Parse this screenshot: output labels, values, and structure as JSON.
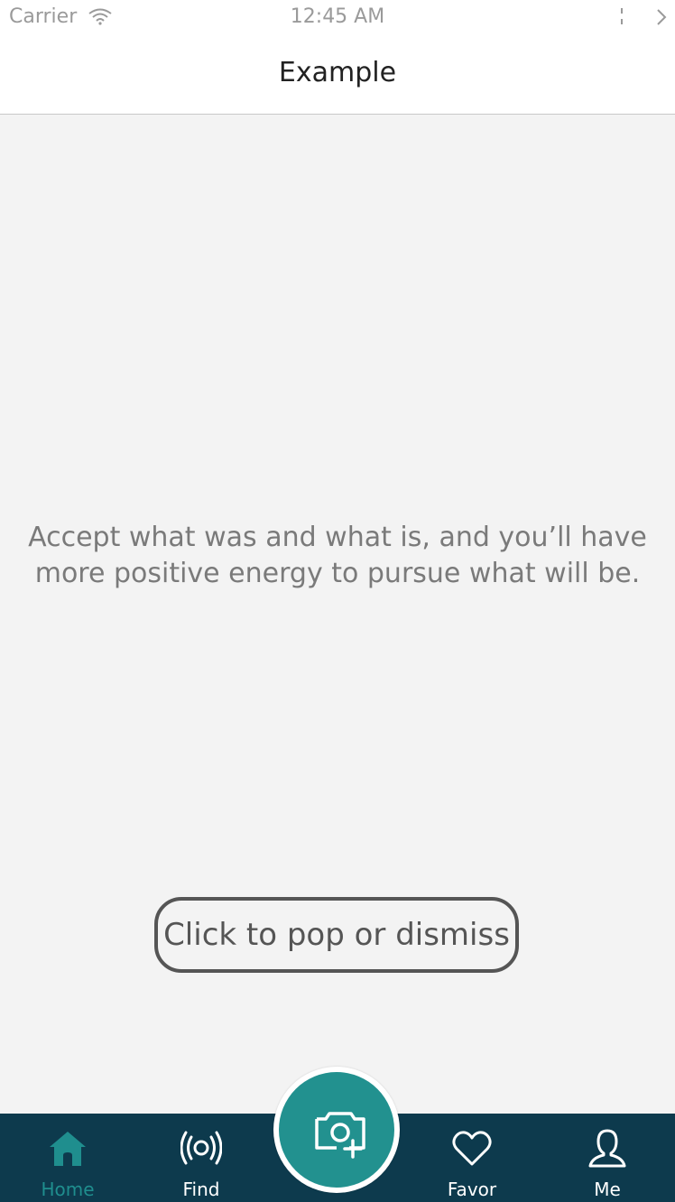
{
  "status_bar": {
    "carrier": "Carrier",
    "time": "12:45 AM"
  },
  "nav": {
    "title": "Example"
  },
  "content": {
    "quote": "Accept what was and what is, and you’ll have more positive energy to pursue what will be.",
    "button_label": "Click to pop or dismiss"
  },
  "tab_bar": {
    "items": [
      {
        "label": "Home",
        "icon": "home-icon",
        "active": true
      },
      {
        "label": "Find",
        "icon": "broadcast-icon",
        "active": false
      },
      {
        "label": "Favor",
        "icon": "heart-icon",
        "active": false
      },
      {
        "label": "Me",
        "icon": "user-icon",
        "active": false
      }
    ],
    "center_button_icon": "add-photo-icon"
  },
  "colors": {
    "tab_bar_background": "#0d3a4d",
    "accent": "#22918f",
    "active_tab_label": "#1f8e8e"
  }
}
